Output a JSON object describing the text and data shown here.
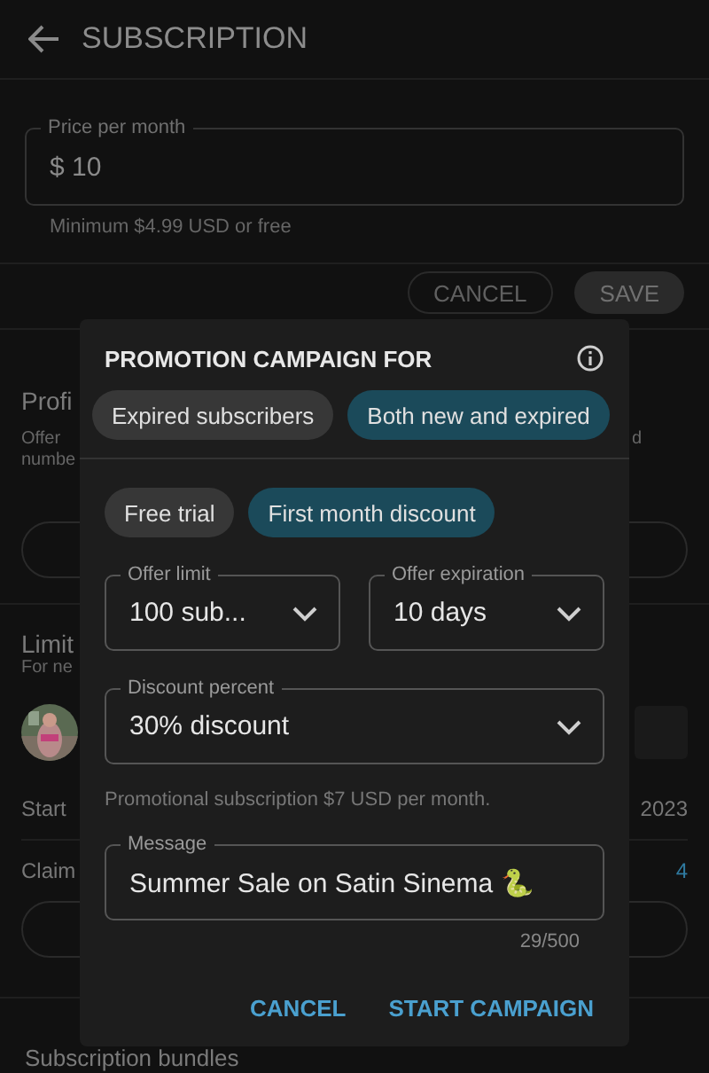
{
  "header": {
    "title": "SUBSCRIPTION"
  },
  "price_field": {
    "label": "Price per month",
    "value": "$ 10",
    "helper": "Minimum $4.99 USD or free"
  },
  "form_buttons": [
    {
      "label": "CANCEL",
      "kind": "outline"
    },
    {
      "label": "SAVE",
      "kind": "filled"
    }
  ],
  "profile_promotion": {
    "title": "Profi",
    "description_lines": [
      "Offer",
      "numbe"
    ],
    "description_end": "d"
  },
  "limited_offer": {
    "title": "Limit",
    "subtitle": "For ne",
    "started_label": "Start",
    "started_value": "2023",
    "claimed_label": "Claim",
    "claimed_value": "4"
  },
  "bundles": {
    "title": "Subscription bundles"
  },
  "dialog": {
    "title": "PROMOTION CAMPAIGN FOR",
    "audience_options": [
      {
        "label": "Expired subscribers",
        "selected": false
      },
      {
        "label": "Both new and expired",
        "selected": true
      }
    ],
    "offer_types": [
      {
        "label": "Free trial",
        "selected": false
      },
      {
        "label": "First month discount",
        "selected": true
      }
    ],
    "offer_limit": {
      "label": "Offer limit",
      "value": "100 sub..."
    },
    "offer_expiration": {
      "label": "Offer expiration",
      "value": "10 days"
    },
    "discount_percent": {
      "label": "Discount percent",
      "value": "30% discount"
    },
    "note": "Promotional subscription $7 USD per month.",
    "message": {
      "label": "Message",
      "value": "Summer Sale on Satin Sinema 🐍",
      "counter": "29/500"
    },
    "actions": [
      "CANCEL",
      "START CAMPAIGN"
    ]
  }
}
